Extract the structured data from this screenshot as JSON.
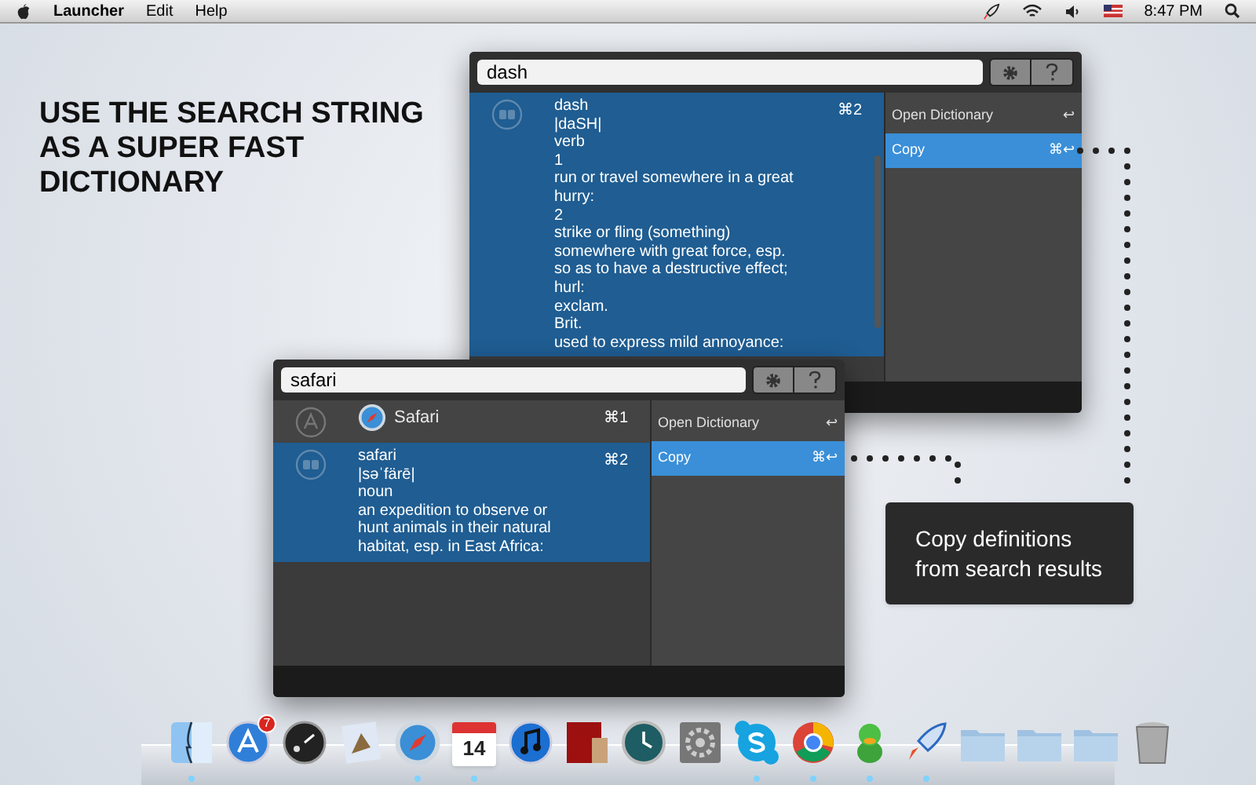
{
  "menubar": {
    "app_menu": "Launcher",
    "menus": [
      "Edit",
      "Help"
    ],
    "clock": "8:47 PM"
  },
  "headline": "USE THE SEARCH STRING AS A SUPER FAST DICTIONARY",
  "windows": [
    {
      "query": "dash",
      "results": [
        {
          "kind": "definition",
          "lines": [
            "dash",
            "|daSH|",
            "verb",
            "1",
            "run or travel somewhere in a great",
            "hurry:",
            "2",
            "strike or fling (something)",
            "somewhere with great force, esp.",
            "so as to have a destructive effect;",
            "hurl:",
            "exclam.",
            "Brit.",
            "used to express mild annoyance:"
          ],
          "shortcut": "⌘2",
          "selected": true
        }
      ],
      "actions": [
        {
          "label": "Open Dictionary",
          "shortcut": "↩",
          "selected": false
        },
        {
          "label": "Copy",
          "shortcut": "⌘↩",
          "selected": true
        }
      ]
    },
    {
      "query": "safari",
      "results": [
        {
          "kind": "app",
          "lines": [
            "Safari"
          ],
          "shortcut": "⌘1",
          "selected": false
        },
        {
          "kind": "definition",
          "lines": [
            "safari",
            "|səˈfärē|",
            "noun",
            "an expedition to observe or",
            "hunt animals in their natural",
            "habitat, esp. in East Africa:"
          ],
          "shortcut": "⌘2",
          "selected": true
        }
      ],
      "actions": [
        {
          "label": "Open Dictionary",
          "shortcut": "↩",
          "selected": false
        },
        {
          "label": "Copy",
          "shortcut": "⌘↩",
          "selected": true
        }
      ]
    }
  ],
  "callout": "Copy definitions from search results",
  "dock": [
    {
      "kind": "finder",
      "running": true
    },
    {
      "kind": "appstore",
      "running": false,
      "badge": "7"
    },
    {
      "kind": "dashboard",
      "running": false
    },
    {
      "kind": "mail",
      "running": false
    },
    {
      "kind": "safari",
      "running": true
    },
    {
      "kind": "calendar",
      "running": true,
      "text": "14"
    },
    {
      "kind": "itunes",
      "running": false
    },
    {
      "kind": "photobooth",
      "running": false
    },
    {
      "kind": "timemachine",
      "running": false
    },
    {
      "kind": "preferences",
      "running": false
    },
    {
      "kind": "skype",
      "running": true
    },
    {
      "kind": "chrome",
      "running": true
    },
    {
      "kind": "adium",
      "running": true
    },
    {
      "kind": "rocket",
      "running": true
    },
    {
      "kind": "folder",
      "running": false
    },
    {
      "kind": "folder",
      "running": false
    },
    {
      "kind": "folder",
      "running": false
    },
    {
      "kind": "trash",
      "running": false
    }
  ]
}
